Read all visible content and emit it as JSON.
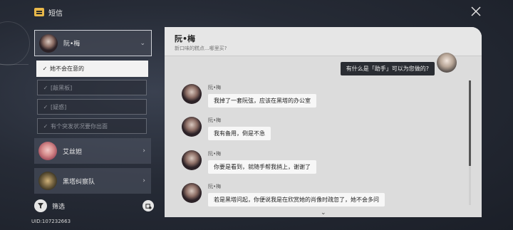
{
  "app": {
    "title": "短信",
    "uid": "UID:107232663"
  },
  "sidebar": {
    "contacts": [
      {
        "name": "阮•梅",
        "chevron": "⌄"
      },
      {
        "name": "艾丝妲",
        "chevron": "›"
      },
      {
        "name": "黑塔纠察队",
        "chevron": "›"
      }
    ],
    "options": [
      {
        "label": "她不会在意的",
        "tick": "✓"
      },
      {
        "label": "[敲黑板]",
        "tick": "✓"
      },
      {
        "label": "[疑惑]",
        "tick": "✓"
      },
      {
        "label": "有个突发状况要你出面",
        "tick": "✓"
      }
    ],
    "filter_label": "筛选"
  },
  "chat": {
    "name": "阮•梅",
    "subtitle": "新口味的糕点...哪里买?",
    "out_message": "有什么是「助手」可以为您做的?",
    "messages": [
      {
        "sender": "阮•梅",
        "text": "我掉了一套阮弦，应该在黑塔的办公室"
      },
      {
        "sender": "阮•梅",
        "text": "我有备用，倒是不急"
      },
      {
        "sender": "阮•梅",
        "text": "你要是看到，就随手帮我捎上，谢谢了"
      },
      {
        "sender": "阮•梅",
        "text": "若是黑塔问起，你便说我是在欣赏她的肖像时疏忽了，她不会多问"
      }
    ],
    "more_indicator": "⌄"
  },
  "colors": {
    "selected_option_bg": "#f2f2f2",
    "app_icon": "#e8b84a",
    "chat_bg": "#dcdcdc",
    "out_bubble": "#2a2d33"
  }
}
